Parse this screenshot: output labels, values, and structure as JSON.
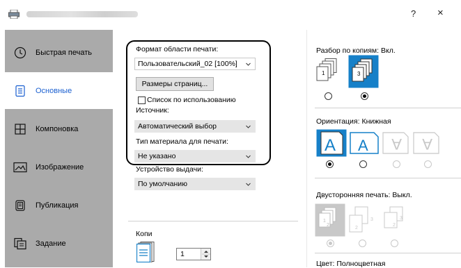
{
  "window": {
    "help_label": "?",
    "close_label": "×"
  },
  "sidebar": {
    "items": [
      {
        "label": "Быстрая печать",
        "icon": "clock-icon"
      },
      {
        "label": "Основные",
        "icon": "document-icon"
      },
      {
        "label": "Компоновка",
        "icon": "layout-grid-icon"
      },
      {
        "label": "Изображение",
        "icon": "image-icon"
      },
      {
        "label": "Публикация",
        "icon": "publication-icon"
      },
      {
        "label": "Задание",
        "icon": "job-icon"
      }
    ],
    "active_index": 1
  },
  "basic": {
    "print_size_label": "Формат области печати:",
    "print_size_value": "Пользовательский_02 [100%]",
    "page_sizes_button": "Размеры страниц...",
    "default_list_label": "Список по использованию",
    "default_list_checked": false,
    "source_label": "Источник:",
    "source_value": "Автоматический выбор",
    "media_type_label": "Тип материала для печати:",
    "media_type_value": "Не указано",
    "output_label": "Устройство выдачи:",
    "output_value": "По умолчанию",
    "copies_label": "Копи",
    "copies_value": "1"
  },
  "right": {
    "collate_label": "Разбор по копиям:",
    "collate_value": "Вкл.",
    "collate_selected": 1,
    "orientation_label": "Ориентация:",
    "orientation_value": "Книжная",
    "orientation_selected": 0,
    "duplex_label": "Двусторонняя печать:",
    "duplex_value": "Выкл.",
    "color_label": "Цвет:",
    "color_value": "Полноцветная"
  },
  "colors": {
    "accent": "#1a5fd0",
    "sidebar_bg": "#aaaaaa",
    "orientation_blue": "#1680c8",
    "disabled": "#c8c8c8"
  }
}
